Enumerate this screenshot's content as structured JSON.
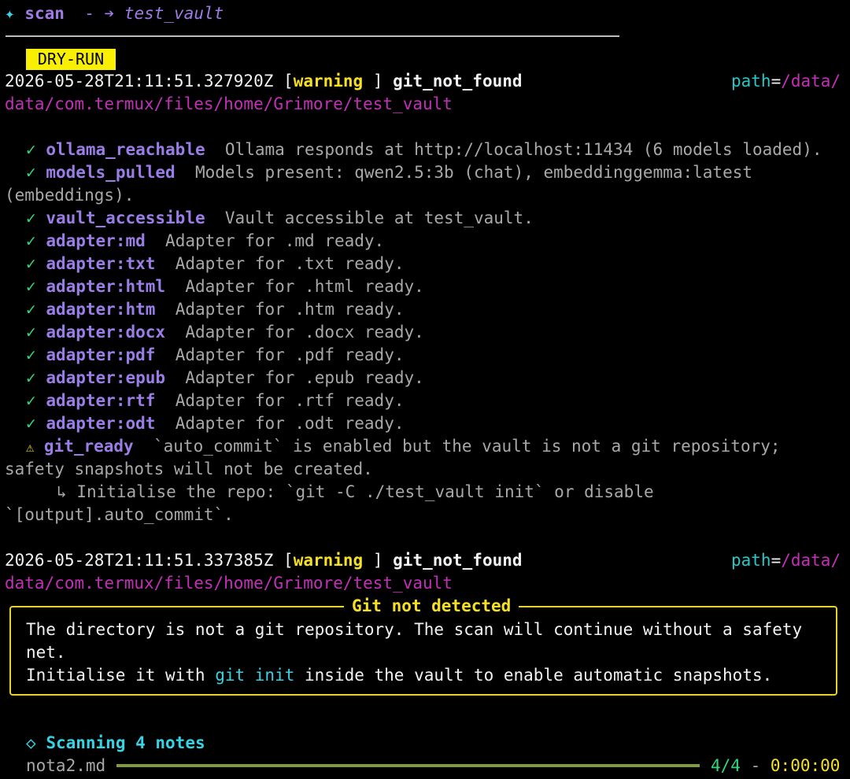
{
  "header": {
    "icon": "✦",
    "command": "scan",
    "dash": "-",
    "arrow": "➔",
    "target": "test_vault"
  },
  "mode_badge": "DRY-RUN",
  "logs": [
    {
      "timestamp": "2026-05-28T21:11:51.327920Z",
      "bracket_open": "[",
      "level": "warning",
      "bracket_close": " ]",
      "event": "git_not_found",
      "path_key": "path",
      "path_eq": "=",
      "path_value_start": "/data/",
      "path_value_rest": "data/com.termux/files/home/Grimore/test_vault"
    },
    {
      "timestamp": "2026-05-28T21:11:51.337385Z",
      "bracket_open": "[",
      "level": "warning",
      "bracket_close": " ]",
      "event": "git_not_found",
      "path_key": "path",
      "path_eq": "=",
      "path_value_start": "/data/",
      "path_value_rest": "data/com.termux/files/home/Grimore/test_vault"
    }
  ],
  "checks": [
    {
      "mark": "✓",
      "name": "ollama_reachable",
      "message": "Ollama responds at http://localhost:11434 (6 models loaded)."
    },
    {
      "mark": "✓",
      "name": "models_pulled",
      "message": "Models present: qwen2.5:3b (chat), embeddinggemma:latest",
      "message_cont": "(embeddings)."
    },
    {
      "mark": "✓",
      "name": "vault_accessible",
      "message": "Vault accessible at test_vault."
    },
    {
      "mark": "✓",
      "name": "adapter:md",
      "message": "Adapter for .md ready."
    },
    {
      "mark": "✓",
      "name": "adapter:txt",
      "message": "Adapter for .txt ready."
    },
    {
      "mark": "✓",
      "name": "adapter:html",
      "message": "Adapter for .html ready."
    },
    {
      "mark": "✓",
      "name": "adapter:htm",
      "message": "Adapter for .htm ready."
    },
    {
      "mark": "✓",
      "name": "adapter:docx",
      "message": "Adapter for .docx ready."
    },
    {
      "mark": "✓",
      "name": "adapter:pdf",
      "message": "Adapter for .pdf ready."
    },
    {
      "mark": "✓",
      "name": "adapter:epub",
      "message": "Adapter for .epub ready."
    },
    {
      "mark": "✓",
      "name": "adapter:rtf",
      "message": "Adapter for .rtf ready."
    },
    {
      "mark": "✓",
      "name": "adapter:odt",
      "message": "Adapter for .odt ready."
    },
    {
      "mark": "⚠",
      "name": "git_ready",
      "message": "`auto_commit` is enabled but the vault is not a git repository;",
      "message_cont": "safety snapshots will not be created."
    }
  ],
  "hint": {
    "arrow": "↳",
    "text": "Initialise the repo: `git -C ./test_vault init` or disable",
    "text_cont": "`[output].auto_commit`."
  },
  "panel": {
    "title": "Git not detected",
    "line1": "The directory is not a git repository. The scan will continue without a safety",
    "line2": "net.",
    "line3_pre": "Initialise it with ",
    "line3_cmd": "git init",
    "line3_post": " inside the vault to enable automatic snapshots."
  },
  "scanning": {
    "icon": "◇",
    "label": "Scanning 4 notes"
  },
  "progress": {
    "file": "nota2.md",
    "fraction": 1.0,
    "count": "4/4",
    "sep": "-",
    "elapsed": "0:00:00"
  },
  "colors": {
    "background": "#000000",
    "warning": "#f5e027",
    "ok": "#33d67a",
    "warn_mark": "#f5e027",
    "path_key": "#27c8c8",
    "path_value": "#c42fb8",
    "check_name": "#9b7de8",
    "accent": "#35d3e3",
    "progress_bar": "#7f9b3c"
  }
}
